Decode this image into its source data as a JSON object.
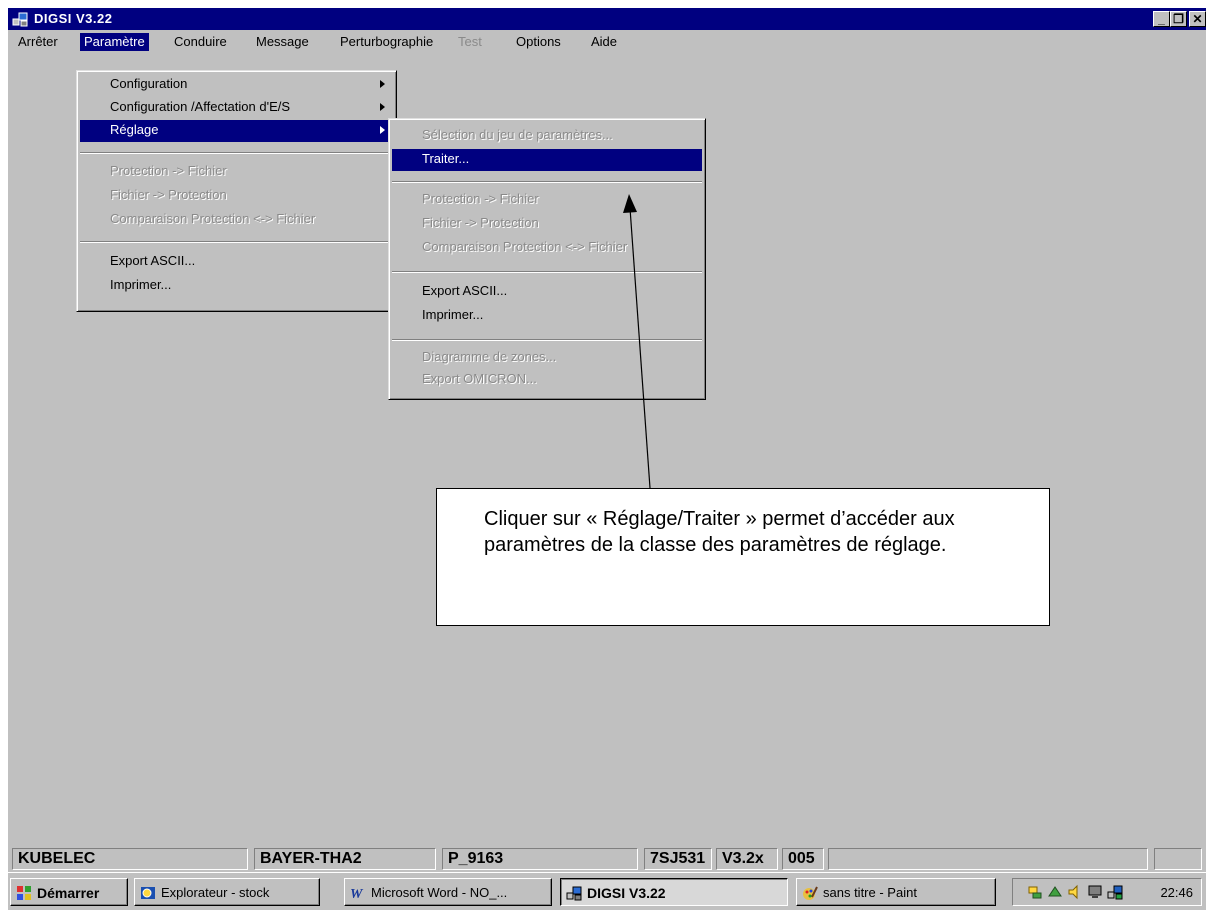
{
  "window": {
    "title": "DIGSI  V3.22"
  },
  "menubar": [
    {
      "label": "Arrêter",
      "active": false,
      "disabled": false
    },
    {
      "label": "Paramètre",
      "active": true,
      "disabled": false
    },
    {
      "label": "Conduire",
      "active": false,
      "disabled": false
    },
    {
      "label": "Message",
      "active": false,
      "disabled": false
    },
    {
      "label": "Perturbographie",
      "active": false,
      "disabled": false
    },
    {
      "label": "Test",
      "active": false,
      "disabled": true
    },
    {
      "label": "Options",
      "active": false,
      "disabled": false
    },
    {
      "label": "Aide",
      "active": false,
      "disabled": false
    }
  ],
  "menu_parametre": {
    "items": [
      {
        "label": "Configuration",
        "submenu": true,
        "disabled": false,
        "highlighted": false
      },
      {
        "label": "Configuration /Affectation d'E/S",
        "submenu": true,
        "disabled": false,
        "highlighted": false
      },
      {
        "label": "Réglage",
        "submenu": true,
        "disabled": false,
        "highlighted": true
      },
      {
        "label": "Protection -> Fichier",
        "disabled": true
      },
      {
        "label": "Fichier -> Protection",
        "disabled": true
      },
      {
        "label": "Comparaison Protection <-> Fichier",
        "disabled": true
      },
      {
        "label": "Export ASCII...",
        "disabled": false
      },
      {
        "label": "Imprimer...",
        "disabled": false
      }
    ]
  },
  "menu_reglage": {
    "items": [
      {
        "label": "Sélection du jeu de paramètres...",
        "disabled": true
      },
      {
        "label": "Traiter...",
        "disabled": false,
        "highlighted": true
      },
      {
        "label": "Protection -> Fichier",
        "disabled": true
      },
      {
        "label": "Fichier -> Protection",
        "disabled": true
      },
      {
        "label": "Comparaison Protection <-> Fichier",
        "disabled": true
      },
      {
        "label": "Export ASCII...",
        "disabled": false
      },
      {
        "label": "Imprimer...",
        "disabled": false
      },
      {
        "label": "Diagramme de zones...",
        "disabled": true
      },
      {
        "label": "Export OMICRON...",
        "disabled": true
      }
    ]
  },
  "callout": {
    "text": "Cliquer sur « Réglage/Traiter » permet d’accéder aux paramètres de la classe des paramètres de réglage."
  },
  "statusbar": [
    "KUBELEC",
    "BAYER-THA2",
    "P_9163",
    "7SJ531",
    "V3.2x",
    "005",
    "",
    ""
  ],
  "taskbar": {
    "start_label": "Démarrer",
    "buttons": [
      "Explorateur - stock",
      "Microsoft Word - NO_...",
      "DIGSI  V3.22",
      "sans titre - Paint"
    ],
    "clock": "22:46"
  }
}
